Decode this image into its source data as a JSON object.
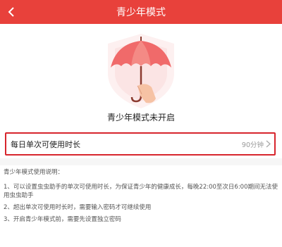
{
  "header": {
    "title": "青少年模式"
  },
  "status_text": "青少年模式未开启",
  "setting": {
    "label": "每日单次可使用时长",
    "value": "90分钟"
  },
  "rules": {
    "title": "青少年模式使用说明：",
    "items": [
      "1、可以设置虫虫助手的单次可使用时长，为保证青少年的健康成长，每晚22:00至次日6:00期间无法使用虫虫助手",
      "2、超出单次可使用时长时，需要输入密码才可继续使用",
      "3、开启青少年模式前，需要先设置独立密码"
    ]
  },
  "colors": {
    "accent": "#e8413b",
    "highlight_border": "#d7252d"
  },
  "icons": {
    "back": "chevron-left-icon",
    "hero": "umbrella-icon",
    "arrow": "chevron-right-icon"
  }
}
